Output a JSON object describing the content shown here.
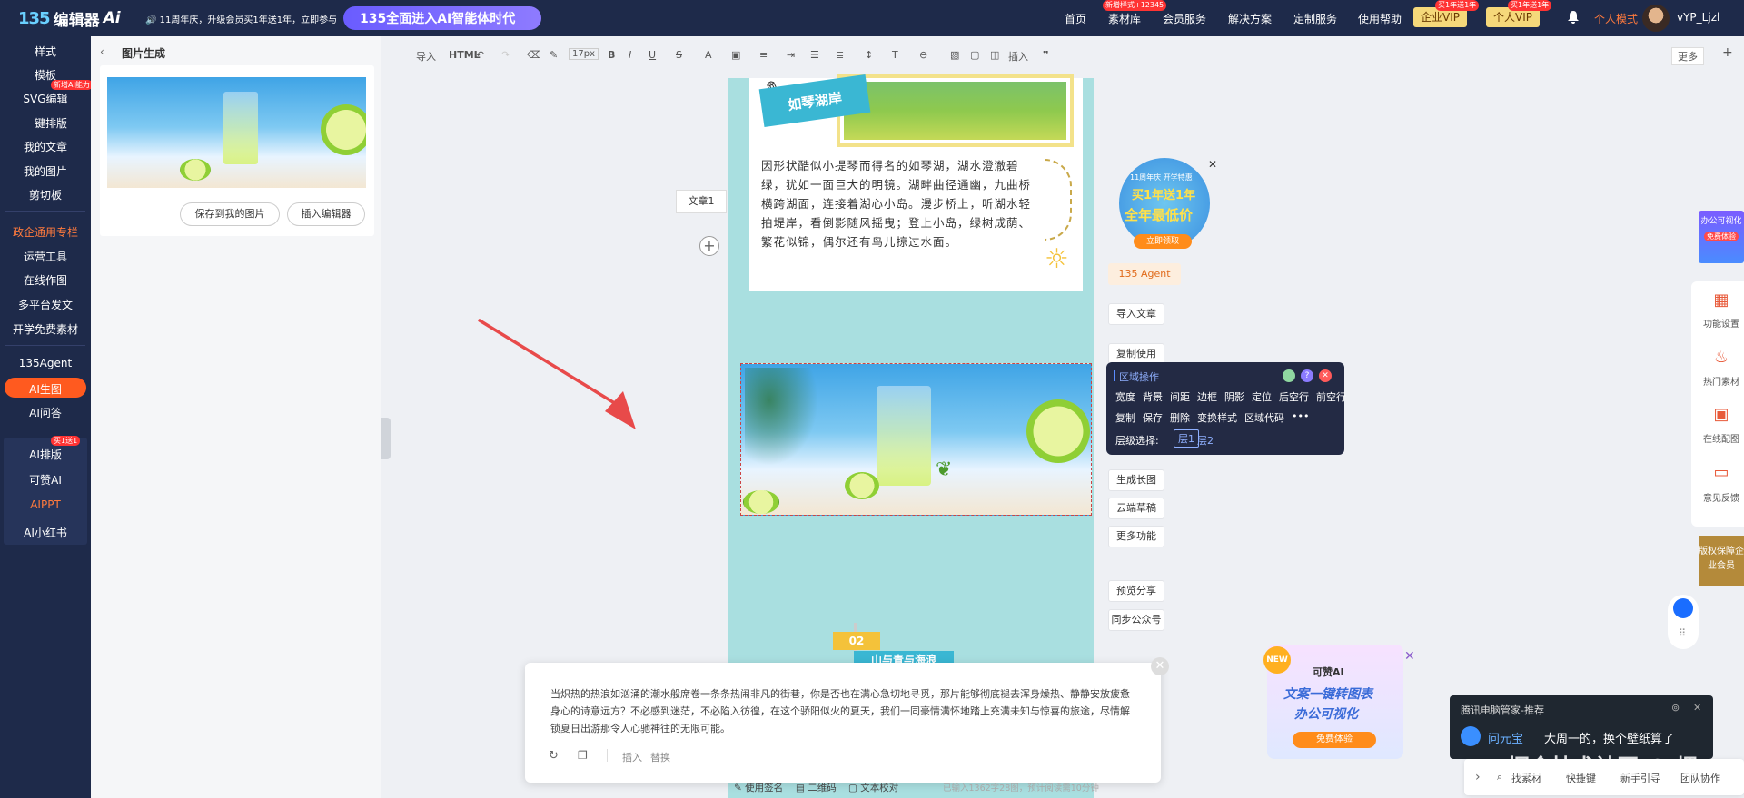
{
  "topbar": {
    "logo_mark": "135",
    "logo_text": "编辑器",
    "logo_ai": "Ai",
    "promo_text": "🔊 11周年庆，升级会员买1年送1年，立即参与",
    "promo_pill": "135全面进入AI智能体时代",
    "nav": [
      "首页",
      "素材库",
      "会员服务",
      "解决方案",
      "定制服务",
      "使用帮助"
    ],
    "nav_badge_material": "新增样式+12345",
    "vip_enterprise": "企业VIP",
    "vip_enterprise_badge": "买1年送1年",
    "vip_personal": "个人VIP",
    "vip_personal_badge": "买1年送1年",
    "personal_mode": "个人模式",
    "username": "vYP_Ljzl"
  },
  "leftnav": {
    "items_top": [
      "样式",
      "模板",
      "SVG编辑",
      "一键排版",
      "我的文章",
      "我的图片",
      "剪切板"
    ],
    "svg_badge": "新增AI能力",
    "section_label": "政企通用专栏",
    "items_mid": [
      "运营工具",
      "在线作图",
      "多平台发文",
      "开学免费素材"
    ],
    "items_ai": [
      "135Agent",
      "AI生图",
      "AI问答"
    ],
    "items_box": [
      "AI排版",
      "可赞AI",
      "AIPPT",
      "AI小红书"
    ],
    "box_badge": "买1送1"
  },
  "panel": {
    "title": "图片生成",
    "save_button": "保存到我的图片",
    "insert_button": "插入编辑器"
  },
  "toolbar": {
    "import": "导入",
    "html": "HTML",
    "font_size": "17px",
    "insert": "插入",
    "more": "更多"
  },
  "article": {
    "doc_tab": "文章1",
    "label": "如琴湖岸",
    "text": "因形状酷似小提琴而得名的如琴湖，湖水澄澈碧绿，犹如一面巨大的明镜。湖畔曲径通幽，九曲桥横跨湖面，连接着湖心小岛。漫步桥上，听湖水轻拍堤岸，看倒影随风摇曳；登上小岛，绿树成荫、繁花似锦，偶尔还有鸟儿掠过水面。",
    "sign": "02",
    "sign_caption": "山与青与海浪"
  },
  "side_buttons": {
    "agent": "135 Agent",
    "import_article": "导入文章",
    "copy_use": "复制使用",
    "long_image": "生成长图",
    "cloud_draft": "云端草稿",
    "more_functions": "更多功能",
    "preview_share": "预览分享",
    "sync_wechat": "同步公众号"
  },
  "region_popup": {
    "title": "区域操作",
    "row1": [
      "宽度",
      "背景",
      "间距",
      "边框",
      "阴影",
      "定位",
      "后空行",
      "前空行"
    ],
    "row2": [
      "复制",
      "保存",
      "删除",
      "变换样式",
      "区域代码",
      "•••"
    ],
    "layer_label": "层级选择:",
    "layers": [
      "层1",
      "层2"
    ]
  },
  "ad_top": {
    "line1": "11周年庆 开学特惠",
    "line2": "买1年送1年",
    "line3": "全年最低价",
    "cta": "立即领取"
  },
  "right_rail": {
    "ad_top": "办公可视化",
    "ad_top_sub": "免费体验",
    "items": [
      "功能设置",
      "热门素材",
      "在线配图",
      "意见反馈"
    ],
    "ad_bottom": "版权保障企业会员"
  },
  "bottom_box": {
    "text": "当炽热的热浪如汹涌的潮水般席卷一条条热闹非凡的街巷，你是否也在满心急切地寻觅，那片能够彻底褪去浑身燥热、静静安放疲惫身心的诗意远方？不必感到迷茫，不必陷入彷徨，在这个骄阳似火的夏天，我们一同豪情满怀地踏上充满未知与惊喜的旅途，尽情解锁夏日出游那令人心驰神往的无限可能。",
    "insert": "插入",
    "replace": "替换"
  },
  "status": {
    "signature": "使用签名",
    "qrcode": "二维码",
    "proofread": "文本校对",
    "count": "已输入1362字28图，预计阅读需10分钟"
  },
  "kejia_ad": {
    "brand": "可赞AI",
    "line1": "文案一键转图表",
    "line2": "办公可视化",
    "cta": "免费体验",
    "tag": "NEW"
  },
  "notification": {
    "title": "腾讯电脑管家-推荐",
    "brand": "问元宝",
    "message": "大周一的，换个壁纸算了"
  },
  "watermark": "掘金技术社区 @ 烟",
  "bottom_search": [
    "找素材",
    "快捷键",
    "新手引导",
    "团队协作"
  ],
  "colors": {
    "nav_bg": "#1e2a4a",
    "accent_orange": "#ff5a1f",
    "promo_purple": "#6a5cff",
    "arrow_red": "#e84a4a"
  }
}
